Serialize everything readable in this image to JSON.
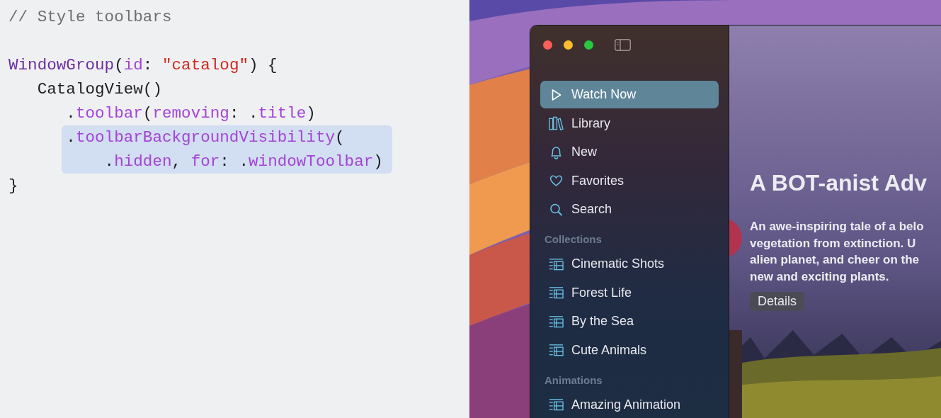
{
  "code": {
    "lines": [
      {
        "highlighted": false,
        "tokens": [
          {
            "kind": "comment",
            "text": "// Style toolbars"
          }
        ]
      },
      {
        "highlighted": false
      },
      {
        "highlighted": false,
        "tokens": [
          {
            "kind": "type",
            "text": "WindowGroup"
          },
          {
            "kind": "plain",
            "text": "("
          },
          {
            "kind": "member",
            "text": "id"
          },
          {
            "kind": "plain",
            "text": ": "
          },
          {
            "kind": "string",
            "text": "\"catalog\""
          },
          {
            "kind": "plain",
            "text": ") {"
          }
        ]
      },
      {
        "highlighted": false,
        "tokens": [
          {
            "kind": "plain",
            "text": "   CatalogView()"
          }
        ]
      },
      {
        "highlighted": false,
        "tokens": [
          {
            "kind": "plain",
            "text": "      ."
          },
          {
            "kind": "member",
            "text": "toolbar"
          },
          {
            "kind": "plain",
            "text": "("
          },
          {
            "kind": "member",
            "text": "removing"
          },
          {
            "kind": "plain",
            "text": ": ."
          },
          {
            "kind": "member",
            "text": "title"
          },
          {
            "kind": "plain",
            "text": ")"
          }
        ]
      },
      {
        "highlighted": true,
        "tokens": [
          {
            "kind": "plain",
            "text": "      ."
          },
          {
            "kind": "member",
            "text": "toolbarBackgroundVisibility"
          },
          {
            "kind": "plain",
            "text": "("
          }
        ]
      },
      {
        "highlighted": true,
        "tokens": [
          {
            "kind": "plain",
            "text": "          ."
          },
          {
            "kind": "member",
            "text": "hidden"
          },
          {
            "kind": "plain",
            "text": ", "
          },
          {
            "kind": "member",
            "text": "for"
          },
          {
            "kind": "plain",
            "text": ": ."
          },
          {
            "kind": "member",
            "text": "windowToolbar"
          },
          {
            "kind": "plain",
            "text": ")"
          }
        ]
      },
      {
        "highlighted": false,
        "tokens": [
          {
            "kind": "plain",
            "text": "}"
          }
        ]
      }
    ]
  },
  "sidebar": {
    "items": [
      {
        "label": "Watch Now",
        "selected": true
      },
      {
        "label": "Library",
        "selected": false
      },
      {
        "label": "New",
        "selected": false
      },
      {
        "label": "Favorites",
        "selected": false
      },
      {
        "label": "Search",
        "selected": false
      }
    ],
    "sections": [
      {
        "title": "Collections",
        "items": [
          {
            "label": "Cinematic Shots",
            "selected": false
          },
          {
            "label": "Forest Life",
            "selected": false
          },
          {
            "label": "By the Sea",
            "selected": false
          },
          {
            "label": "Cute Animals",
            "selected": false
          }
        ]
      },
      {
        "title": "Animations",
        "items": [
          {
            "label": "Amazing Animation",
            "selected": false
          }
        ]
      }
    ]
  },
  "hero": {
    "title": "A BOT-anist Adv",
    "description": [
      "An awe-inspiring tale of a belo",
      "vegetation from extinction. U",
      "alien planet, and cheer on the",
      "new and exciting plants."
    ],
    "button": "Details"
  }
}
